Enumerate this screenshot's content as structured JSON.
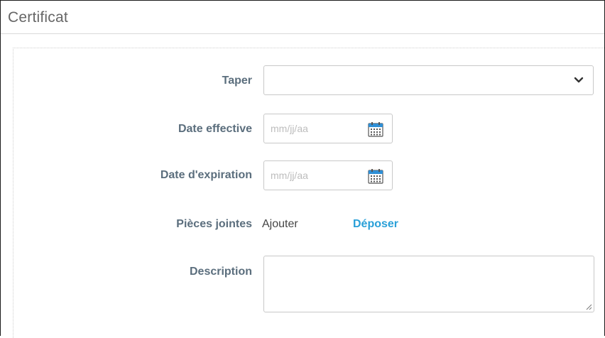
{
  "section": {
    "title": "Certificat"
  },
  "form": {
    "type": {
      "label": "Taper",
      "value": ""
    },
    "effective_date": {
      "label": "Date effective",
      "placeholder": "mm/jj/aa"
    },
    "expiration_date": {
      "label": "Date d'expiration",
      "placeholder": "mm/jj/aa"
    },
    "attachments": {
      "label": "Pièces jointes",
      "add_label": "Ajouter",
      "upload_label": "Déposer"
    },
    "description": {
      "label": "Description",
      "value": ""
    }
  },
  "icons": {
    "dropdown": "chevron-down-icon",
    "calendar": "calendar-icon",
    "resize": "resize-grip-icon"
  },
  "colors": {
    "label": "#5b6e7d",
    "link": "#2aa0d8",
    "calendar_accent": "#2f8fd6"
  }
}
